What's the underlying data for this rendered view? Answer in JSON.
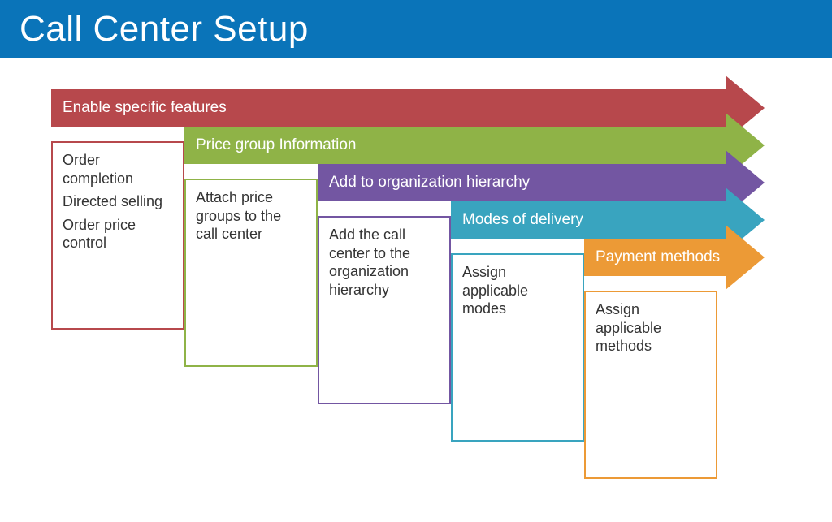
{
  "title": "Call Center Setup",
  "steps": {
    "s1": {
      "label": "Enable specific features",
      "items": [
        "Order completion",
        "Directed selling",
        "Order price control"
      ]
    },
    "s2": {
      "label": "Price group Information",
      "items": [
        "Attach price groups to the call center"
      ]
    },
    "s3": {
      "label": "Add to organization hierarchy",
      "items": [
        "Add the call center to the organization hierarchy"
      ]
    },
    "s4": {
      "label": "Modes of delivery",
      "items": [
        "Assign applicable modes"
      ]
    },
    "s5": {
      "label": "Payment methods",
      "items": [
        "Assign applicable methods"
      ]
    }
  },
  "colors": {
    "title_bg": "#0a74b9",
    "s1": "#b7484c",
    "s2": "#8fb347",
    "s3": "#7356a2",
    "s4": "#39a4bf",
    "s5": "#ec9a36"
  }
}
